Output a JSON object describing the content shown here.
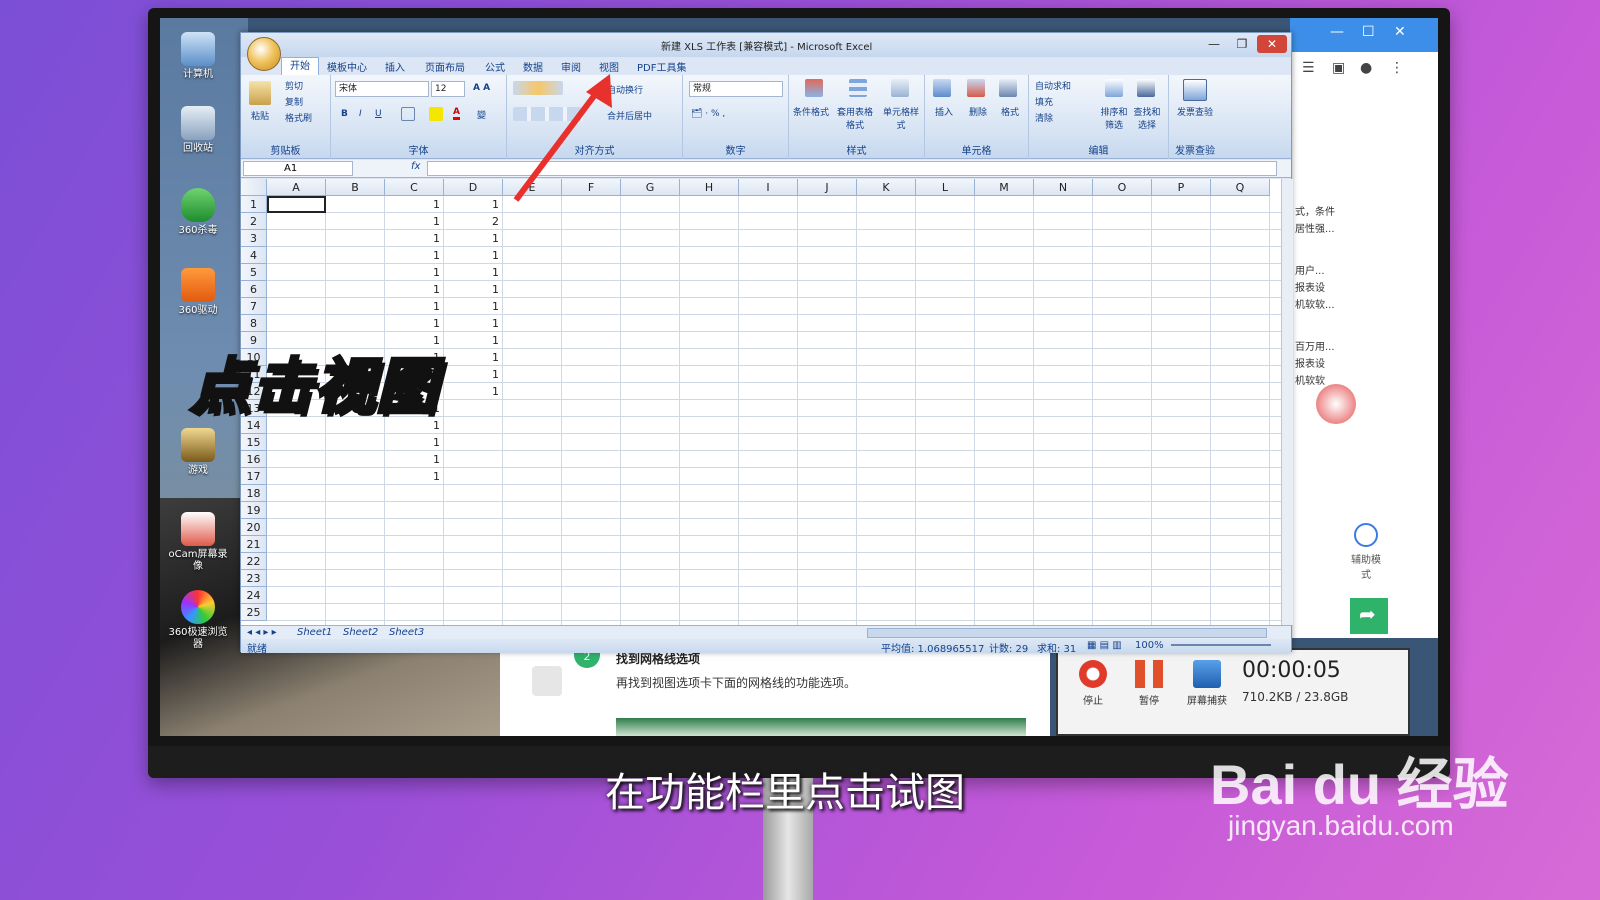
{
  "desktop_icons": [
    {
      "label": "计算机"
    },
    {
      "label": "回收站"
    },
    {
      "label": "360杀毒"
    },
    {
      "label": "360驱动"
    },
    {
      "label": "游戏"
    },
    {
      "label": "oCam屏幕录像"
    },
    {
      "label": "360极速浏览器"
    }
  ],
  "excel": {
    "title": "新建 XLS 工作表 [兼容模式] - Microsoft Excel",
    "tabs": [
      "开始",
      "模板中心",
      "插入",
      "页面布局",
      "公式",
      "数据",
      "审阅",
      "视图",
      "PDF工具集"
    ],
    "clipboard": {
      "paste": "粘贴",
      "cut": "剪切",
      "copy": "复制",
      "format_painter": "格式刷",
      "label": "剪贴板"
    },
    "font": {
      "name": "宋体",
      "size": "12",
      "label": "字体"
    },
    "alignment": {
      "wrap": "自动换行",
      "merge": "合并后居中",
      "label": "对齐方式"
    },
    "number": {
      "format": "常规",
      "label": "数字"
    },
    "styles": {
      "conditional": "条件格式",
      "table": "套用表格格式",
      "cell": "单元格样式",
      "label": "样式"
    },
    "cells": {
      "insert": "插入",
      "delete": "删除",
      "format": "格式",
      "label": "单元格"
    },
    "editing": {
      "autosum": "自动求和",
      "fill": "填充",
      "clear": "清除",
      "sort": "排序和筛选",
      "find": "查找和选择",
      "label": "编辑"
    },
    "invoice": {
      "check": "发票查验",
      "label": "发票查验"
    },
    "name_box": "A1",
    "fx": "fx",
    "columns": [
      "A",
      "B",
      "C",
      "D",
      "E",
      "F",
      "G",
      "H",
      "I",
      "J",
      "K",
      "L",
      "M",
      "N",
      "O",
      "P",
      "Q"
    ],
    "rows": [
      "1",
      "2",
      "3",
      "4",
      "5",
      "6",
      "7",
      "8",
      "9",
      "10",
      "11",
      "12",
      "13",
      "14",
      "15",
      "16",
      "17",
      "18",
      "19",
      "20",
      "21",
      "22",
      "23",
      "24",
      "25"
    ],
    "col_c": [
      "1",
      "1",
      "1",
      "1",
      "1",
      "1",
      "1",
      "1",
      "1",
      "1",
      "1",
      "1",
      "1",
      "1",
      "1",
      "1",
      "1"
    ],
    "col_d": [
      "1",
      "2",
      "1",
      "1",
      "1",
      "1",
      "1",
      "1",
      "1",
      "1",
      "1",
      "1"
    ],
    "sheets": [
      "Sheet1",
      "Sheet2",
      "Sheet3"
    ],
    "status": {
      "ready": "就绪",
      "average": "平均值: 1.068965517",
      "count": "计数: 29",
      "sum": "求和: 31",
      "zoom": "100%"
    }
  },
  "browser_side": {
    "lines": [
      "式，条件",
      "居性强...",
      "用户...",
      "报表设",
      "机软软...",
      "百万用...",
      "报表设",
      "机软软"
    ],
    "help": "辅助模式"
  },
  "article": {
    "step": "2",
    "heading": "找到网格线选项",
    "body": "再找到视图选项卡下面的网格线的功能选项。"
  },
  "recorder": {
    "stop": "停止",
    "pause": "暂停",
    "capture": "屏幕捕获",
    "time": "00:00:05",
    "size": "710.2KB / 23.8GB"
  },
  "overlay": "点击视图",
  "caption": "在功能栏里点击试图",
  "watermark": {
    "brand": "Bai du 经验",
    "url": "jingyan.baidu.com"
  },
  "colors": {
    "arrow": "#e8302c",
    "accent": "#15428b"
  }
}
